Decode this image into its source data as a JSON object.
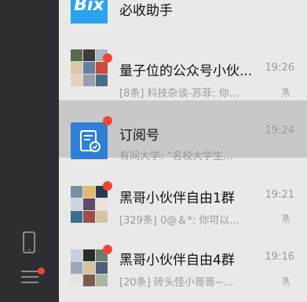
{
  "rail": {
    "phone_icon": "phone-icon",
    "menu_icon": "menu-icon",
    "menu_badge_color": "#f44336"
  },
  "chats": [
    {
      "title": "必收助手",
      "time": "",
      "preview": "",
      "badge": false,
      "muted": false,
      "avatar": "app-logo",
      "avatar_text": "Bix",
      "avatar_color": "#2aa4ee",
      "selected": false
    },
    {
      "title": "量子位的公众号小伙...",
      "time": "19:26",
      "preview": "[8条] 科技杂谈-苏菲: 你...",
      "badge": true,
      "muted": true,
      "avatar": "group-mosaic",
      "selected": false
    },
    {
      "title": "订阅号",
      "time": "19:24",
      "preview": "有间大学: “名校大学生...",
      "badge": true,
      "muted": false,
      "avatar": "subscription-icon",
      "avatar_color": "#2f7fd6",
      "selected": true
    },
    {
      "title": "黑哥小伙伴自由1群",
      "time": "19:21",
      "preview": "[329条] 0@＆*: 你可以...",
      "badge": true,
      "muted": true,
      "avatar": "group-mosaic",
      "selected": false
    },
    {
      "title": "黑哥小伙伴自由4群",
      "time": "19:16",
      "preview": "[20条] 砖头怪小哥哥~...",
      "badge": true,
      "muted": true,
      "avatar": "group-mosaic",
      "selected": false
    }
  ]
}
